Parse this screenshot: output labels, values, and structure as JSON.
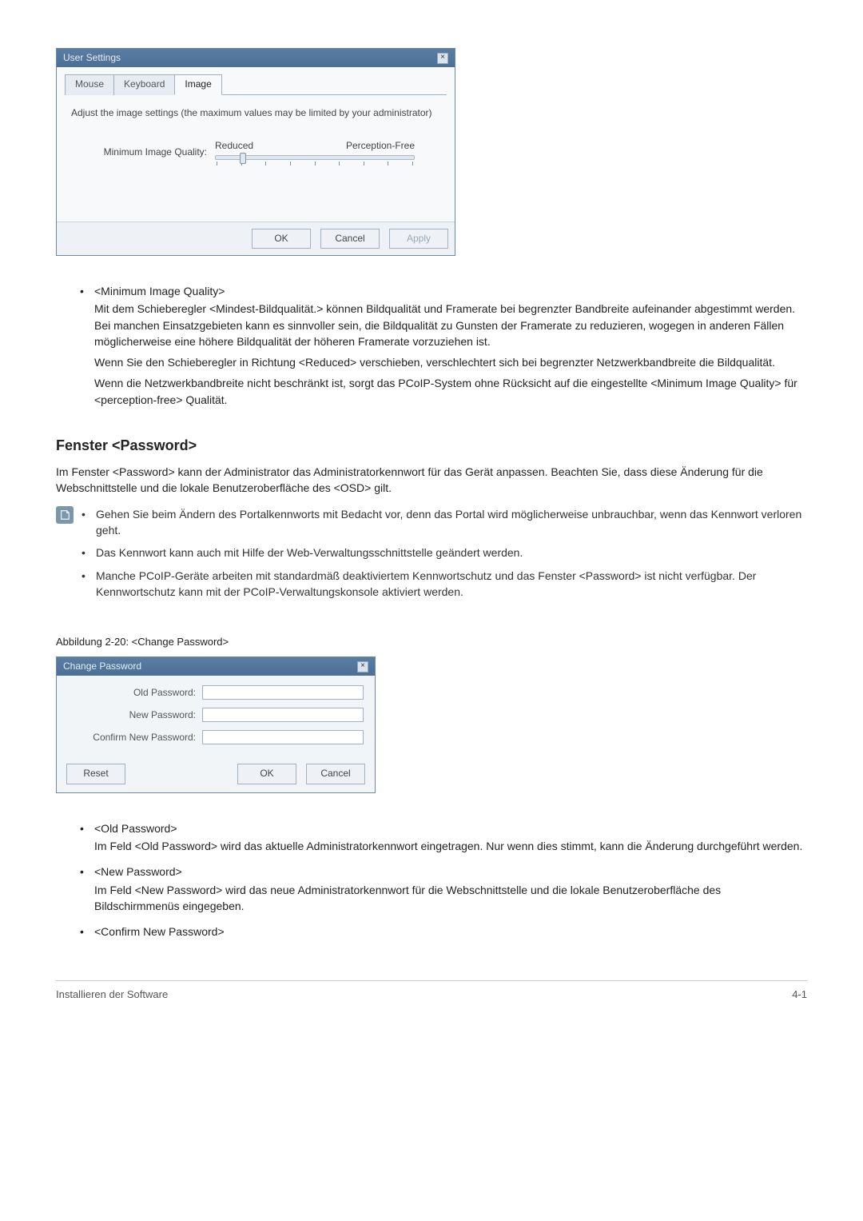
{
  "user_settings": {
    "title": "User Settings",
    "close": "×",
    "tabs": {
      "mouse": "Mouse",
      "keyboard": "Keyboard",
      "image": "Image"
    },
    "desc": "Adjust the image settings (the maximum values may be limited by your administrator)",
    "slider": {
      "label": "Minimum Image Quality:",
      "left": "Reduced",
      "right": "Perception-Free",
      "position_pct": 12
    },
    "buttons": {
      "ok": "OK",
      "cancel": "Cancel",
      "apply": "Apply"
    }
  },
  "bullets1": {
    "title": "<Minimum Image Quality>",
    "p1": "Mit dem Schieberegler <Mindest-Bildqualität.> können Bildqualität und Framerate bei begrenzter Bandbreite aufeinander abgestimmt werden. Bei manchen Einsatzgebieten kann es sinnvoller sein, die Bildqualität zu Gunsten der Framerate zu reduzieren, wogegen in anderen Fällen möglicherweise eine höhere Bildqualität der höheren Framerate vorzuziehen ist.",
    "p2": "Wenn Sie den Schieberegler in Richtung <Reduced> verschieben, verschlechtert sich bei begrenzter Netzwerkbandbreite die Bildqualität.",
    "p3": "Wenn die Netzwerkbandbreite nicht beschränkt ist, sorgt das PCoIP-System ohne Rücksicht auf die eingestellte <Minimum Image Quality> für <perception-free> Qualität."
  },
  "section": {
    "heading": "Fenster <Password>",
    "lead": "Im Fenster <Password> kann der Administrator das Administratorkennwort für das Gerät anpassen. Beachten Sie, dass diese Änderung für die Webschnittstelle und die lokale Benutzeroberfläche des <OSD> gilt."
  },
  "note": {
    "item1": "Gehen Sie beim Ändern des Portalkennworts mit Bedacht vor, denn das Portal wird möglicherweise unbrauchbar, wenn das Kennwort verloren geht.",
    "item2": "Das Kennwort kann auch mit Hilfe der Web-Verwaltungsschnittstelle geändert werden.",
    "item3": "Manche PCoIP-Geräte arbeiten mit standardmäß deaktiviertem Kennwortschutz und das Fenster <Password> ist nicht verfügbar. Der Kennwortschutz kann mit der PCoIP-Verwaltungskonsole aktiviert werden."
  },
  "fig_caption": "Abbildung 2-20: <Change Password>",
  "change_pw": {
    "title": "Change Password",
    "close": "×",
    "old": "Old Password:",
    "new": "New Password:",
    "confirm": "Confirm New Password:",
    "reset": "Reset",
    "ok": "OK",
    "cancel": "Cancel"
  },
  "bullets2": {
    "t1": "<Old Password>",
    "b1": "Im Feld <Old Password> wird das aktuelle Administratorkennwort eingetragen. Nur wenn dies stimmt, kann die Änderung durchgeführt werden.",
    "t2": "<New Password>",
    "b2": "Im Feld <New Password> wird das neue Administratorkennwort für die Webschnittstelle und die lokale Benutzeroberfläche des Bildschirmmenüs eingegeben.",
    "t3": "<Confirm New Password>"
  },
  "footer": {
    "left": "Installieren der Software",
    "right": "4-1"
  }
}
